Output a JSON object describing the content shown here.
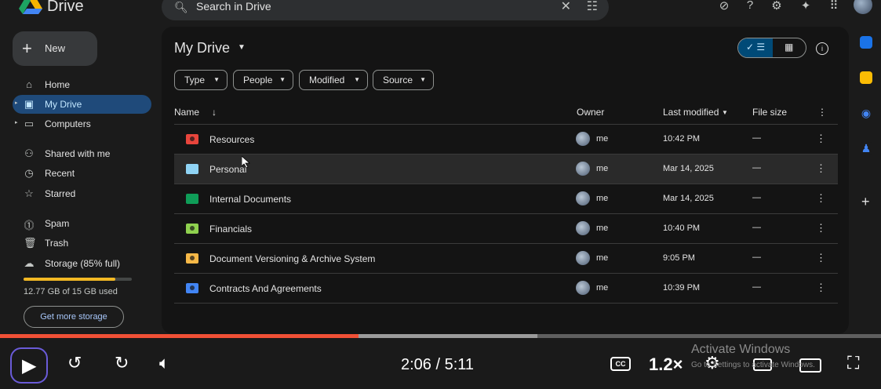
{
  "app": {
    "name": "Drive"
  },
  "search": {
    "placeholder": "Search in Drive"
  },
  "top_icons": [
    "status-icon",
    "help-icon",
    "settings-icon",
    "gemini-icon",
    "apps-icon",
    "account-avatar"
  ],
  "sidebar": {
    "new_label": "New",
    "items": [
      {
        "label": "Home",
        "icon": "home-icon"
      },
      {
        "label": "My Drive",
        "icon": "drive-icon",
        "active": true
      },
      {
        "label": "Computers",
        "icon": "computer-icon"
      },
      {
        "label": "Shared with me",
        "icon": "shared-icon"
      },
      {
        "label": "Recent",
        "icon": "clock-icon"
      },
      {
        "label": "Starred",
        "icon": "star-icon"
      },
      {
        "label": "Spam",
        "icon": "spam-icon"
      },
      {
        "label": "Trash",
        "icon": "trash-icon"
      },
      {
        "label": "Storage (85% full)",
        "icon": "cloud-icon"
      }
    ],
    "storage_used_fraction": 0.85,
    "storage_text": "12.77 GB of 15 GB used",
    "get_more": "Get more storage"
  },
  "main": {
    "title": "My Drive",
    "filters": [
      "Type",
      "People",
      "Modified",
      "Source"
    ],
    "columns": {
      "name": "Name",
      "owner": "Owner",
      "modified": "Last modified",
      "size": "File size"
    },
    "rows": [
      {
        "name": "Resources",
        "owner": "me",
        "modified": "10:42 PM",
        "size": "—",
        "color": "#e8453c",
        "shared": true
      },
      {
        "name": "Personal",
        "owner": "me",
        "modified": "Mar 14, 2025",
        "size": "—",
        "color": "#8fd3f4",
        "shared": false
      },
      {
        "name": "Internal Documents",
        "owner": "me",
        "modified": "Mar 14, 2025",
        "size": "—",
        "color": "#0f9d58",
        "shared": false
      },
      {
        "name": "Financials",
        "owner": "me",
        "modified": "10:40 PM",
        "size": "—",
        "color": "#8fd14f",
        "shared": true
      },
      {
        "name": "Document Versioning & Archive System",
        "owner": "me",
        "modified": "9:05 PM",
        "size": "—",
        "color": "#f6b847",
        "shared": true
      },
      {
        "name": "Contracts And Agreements",
        "owner": "me",
        "modified": "10:39 PM",
        "size": "—",
        "color": "#4285f4",
        "shared": true
      }
    ]
  },
  "player": {
    "time": "2:06 / 5:11",
    "speed": "1.2×",
    "played_fraction": 0.407,
    "buffered_fraction": 0.61,
    "cc": "CC"
  },
  "watermark": {
    "line1": "Activate Windows",
    "line2": "Go to Settings to activate Windows."
  }
}
